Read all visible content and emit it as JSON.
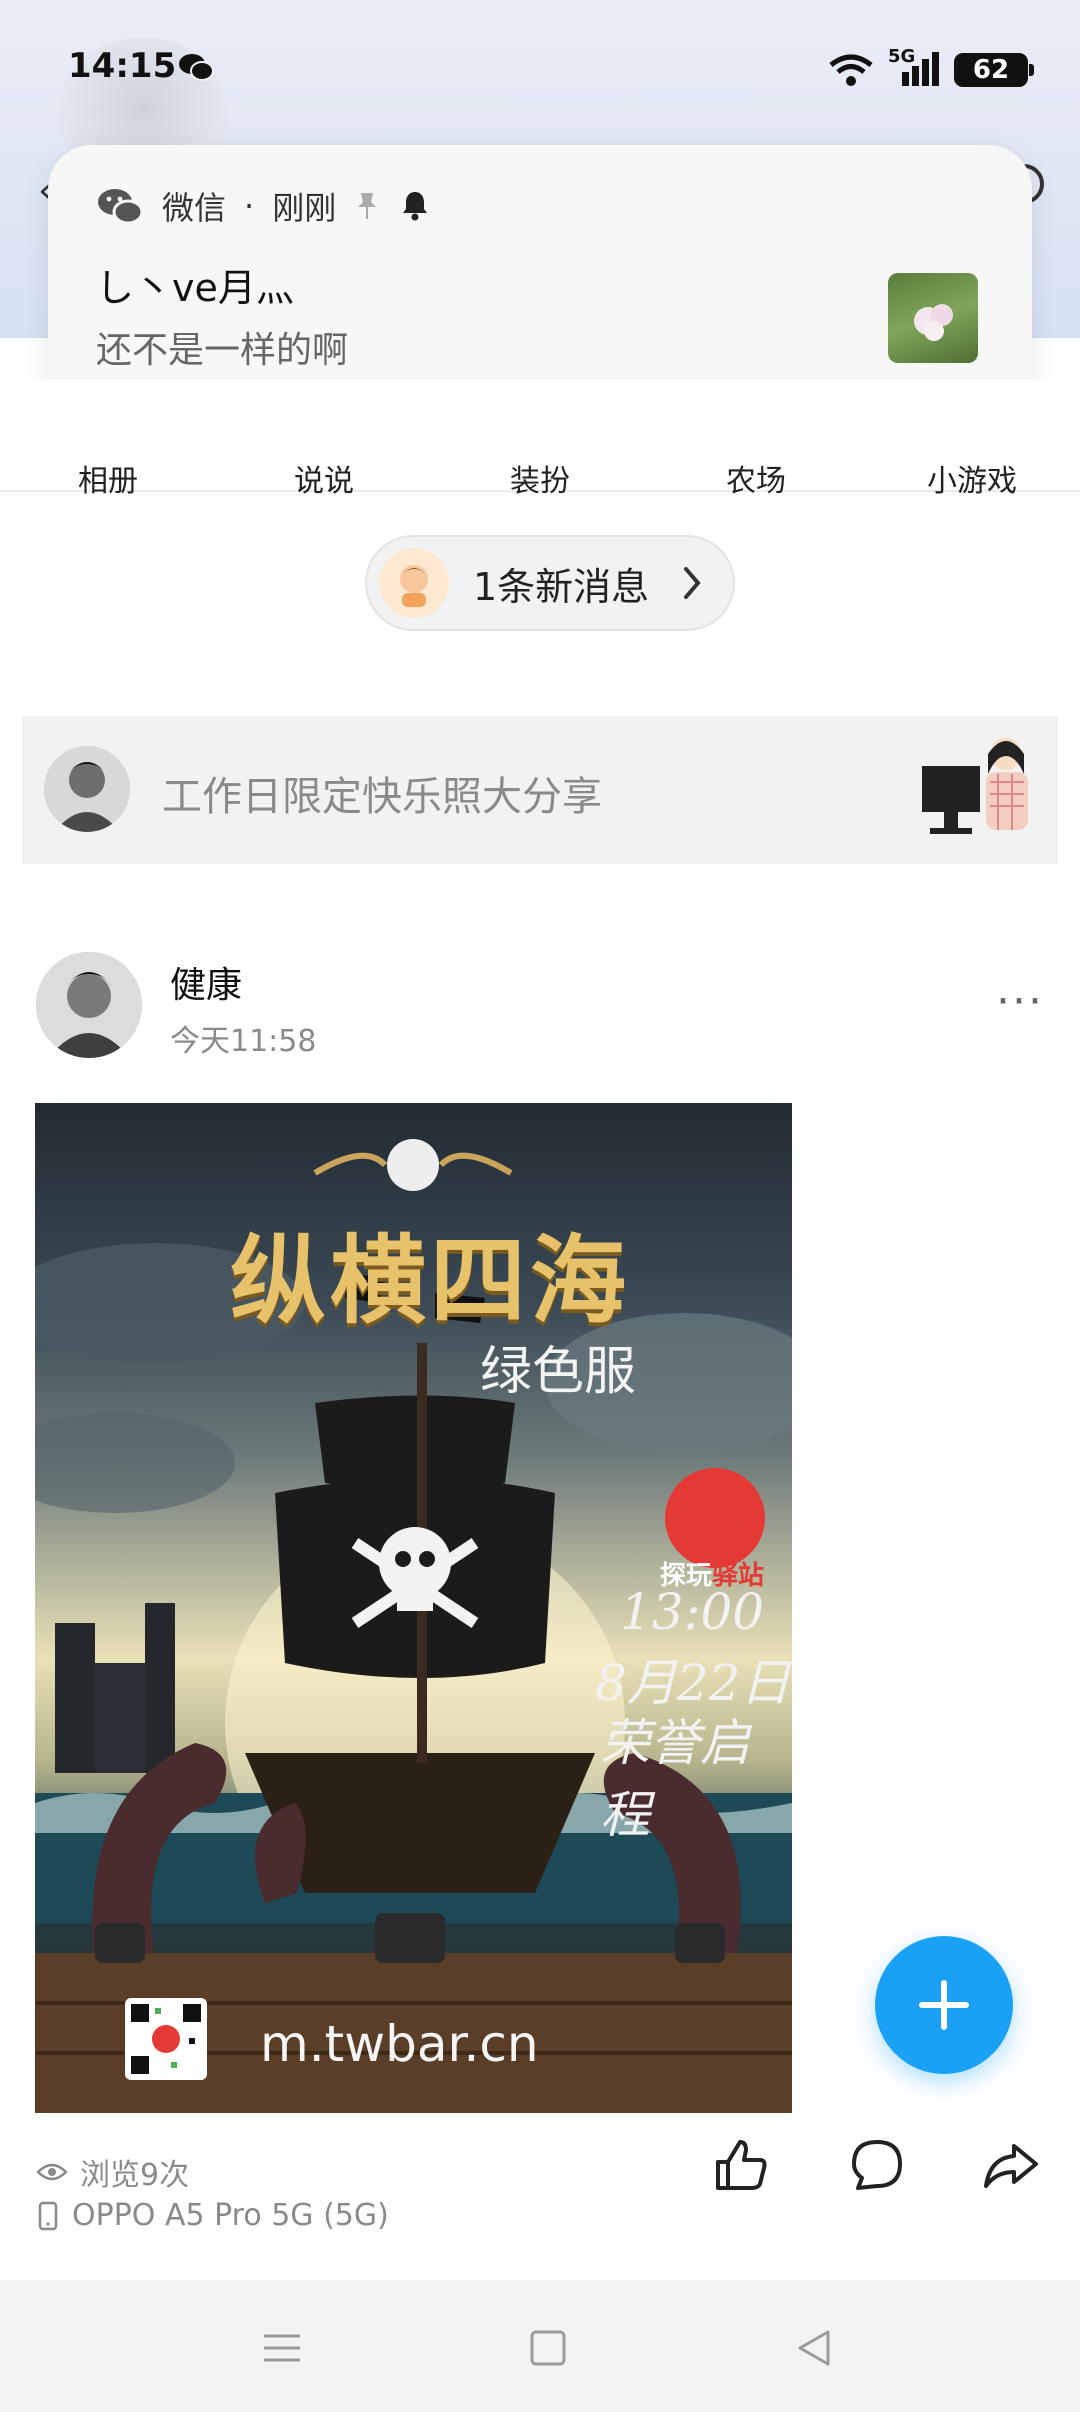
{
  "status_bar": {
    "time": "14:15",
    "network": "5G",
    "battery": "62"
  },
  "notification": {
    "app_name": "微信",
    "separator": "·",
    "time": "刚刚",
    "sender": "し丶ve月灬",
    "message": "还不是一样的啊"
  },
  "nav": {
    "items": [
      {
        "label": "相册",
        "icon": "album-icon"
      },
      {
        "label": "说说",
        "icon": "shuoshuo-icon"
      },
      {
        "label": "装扮",
        "icon": "decorate-icon"
      },
      {
        "label": "农场",
        "icon": "farm-icon"
      },
      {
        "label": "小游戏",
        "icon": "minigame-icon"
      }
    ]
  },
  "new_message": {
    "label": "1条新消息"
  },
  "share_banner": {
    "text": "工作日限定快乐照大分享"
  },
  "post": {
    "author": "健康",
    "time": "今天11:58",
    "image": {
      "title": "纵横四海",
      "subtitle": "绿色服",
      "brand": "探玩",
      "brand_accent": "驿站",
      "time_text": "13:00",
      "date_text": "8月22日",
      "slogan": "荣誉启程",
      "url": "m.twbar.cn"
    },
    "views": "浏览9次",
    "device": "OPPO A5 Pro 5G (5G)"
  },
  "colors": {
    "accent": "#1aa1f5",
    "muted": "#8a8a8a"
  }
}
